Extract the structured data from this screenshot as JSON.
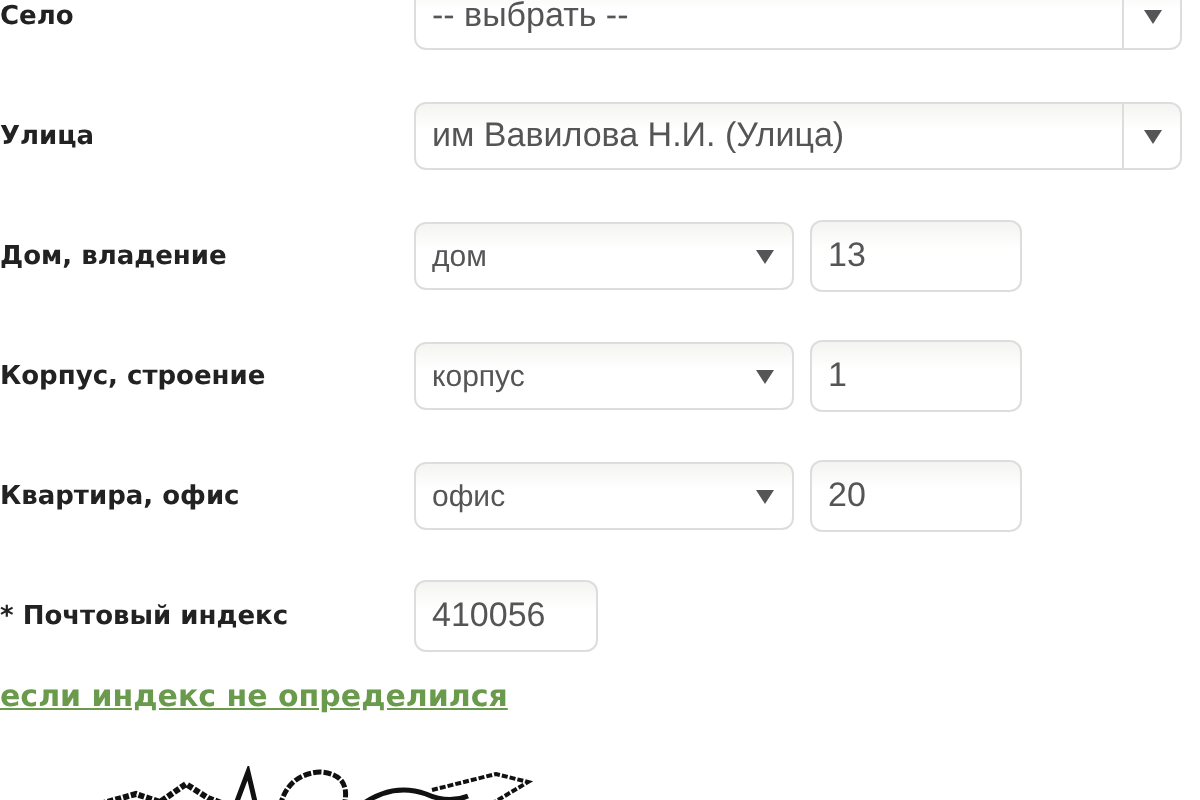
{
  "fields": [
    {
      "kind": "select",
      "label": "Село",
      "value": "-- выбрать --"
    },
    {
      "kind": "select",
      "label": "Улица",
      "value": "им Вавилова Н.И. (Улица)"
    },
    {
      "kind": "pair",
      "label": "Дом, владение",
      "value": "дом",
      "number": "13"
    },
    {
      "kind": "pair",
      "label": "Корпус, строение",
      "value": "корпус",
      "number": "1"
    },
    {
      "kind": "pair",
      "label": "Квартира, офис",
      "value": "офис",
      "number": "20"
    },
    {
      "kind": "input",
      "label": "* Почтовый индекс",
      "value": "410056"
    }
  ],
  "link": "если индекс не определился"
}
